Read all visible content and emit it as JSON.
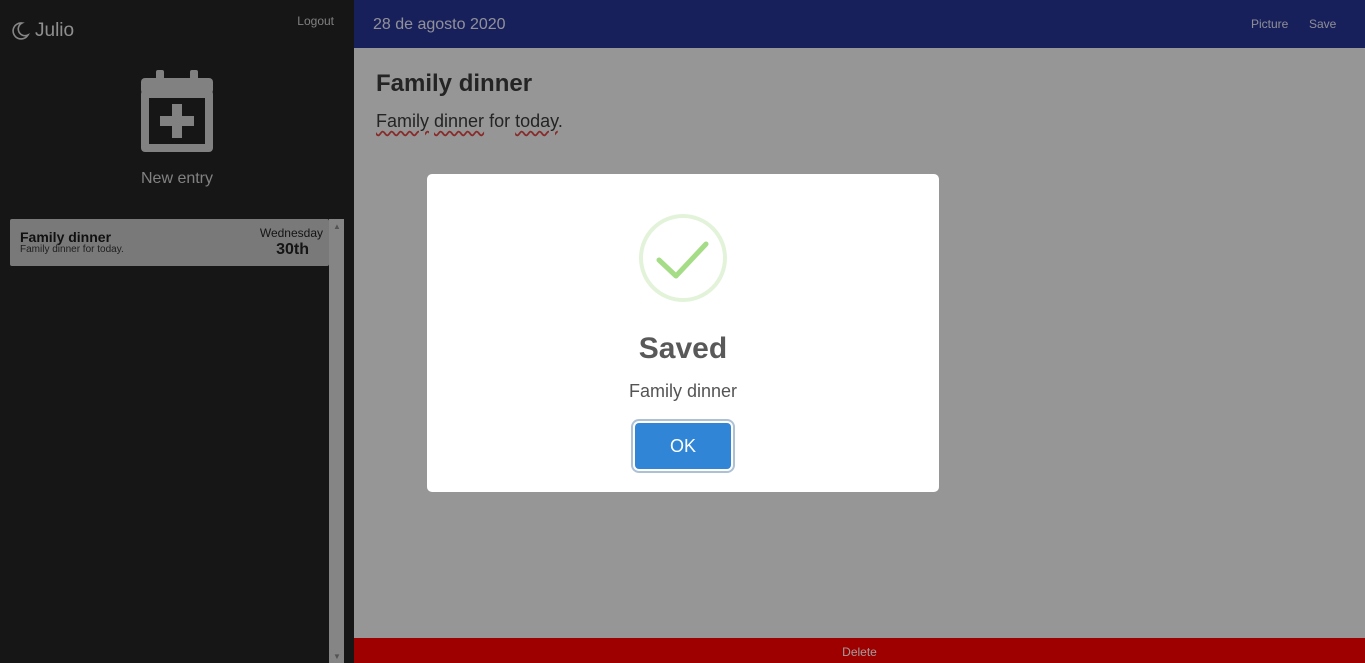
{
  "colors": {
    "sidebar_bg": "#242424",
    "topbar_bg": "#283593",
    "delete_bg": "#ff0000",
    "ok_button": "#3085d6",
    "success_check": "#a5dc86"
  },
  "sidebar": {
    "brand_icon": "moon-icon",
    "brand_name": "Julio",
    "logout_label": "Logout",
    "new_entry_icon": "calendar-plus-icon",
    "new_entry_label": "New entry",
    "entries": [
      {
        "title": "Family dinner",
        "snippet": "Family dinner for today.",
        "weekday": "Wednesday",
        "day": "30th"
      }
    ]
  },
  "main": {
    "date": "28 de agosto 2020",
    "picture_label": "Picture",
    "save_label": "Save",
    "entry_title": "Family dinner",
    "entry_body_words": [
      "Family",
      "dinner",
      "for",
      "today",
      "."
    ],
    "delete_label": "Delete"
  },
  "dialog": {
    "icon": "success-check-icon",
    "title": "Saved",
    "message": "Family dinner",
    "ok_label": "OK"
  }
}
